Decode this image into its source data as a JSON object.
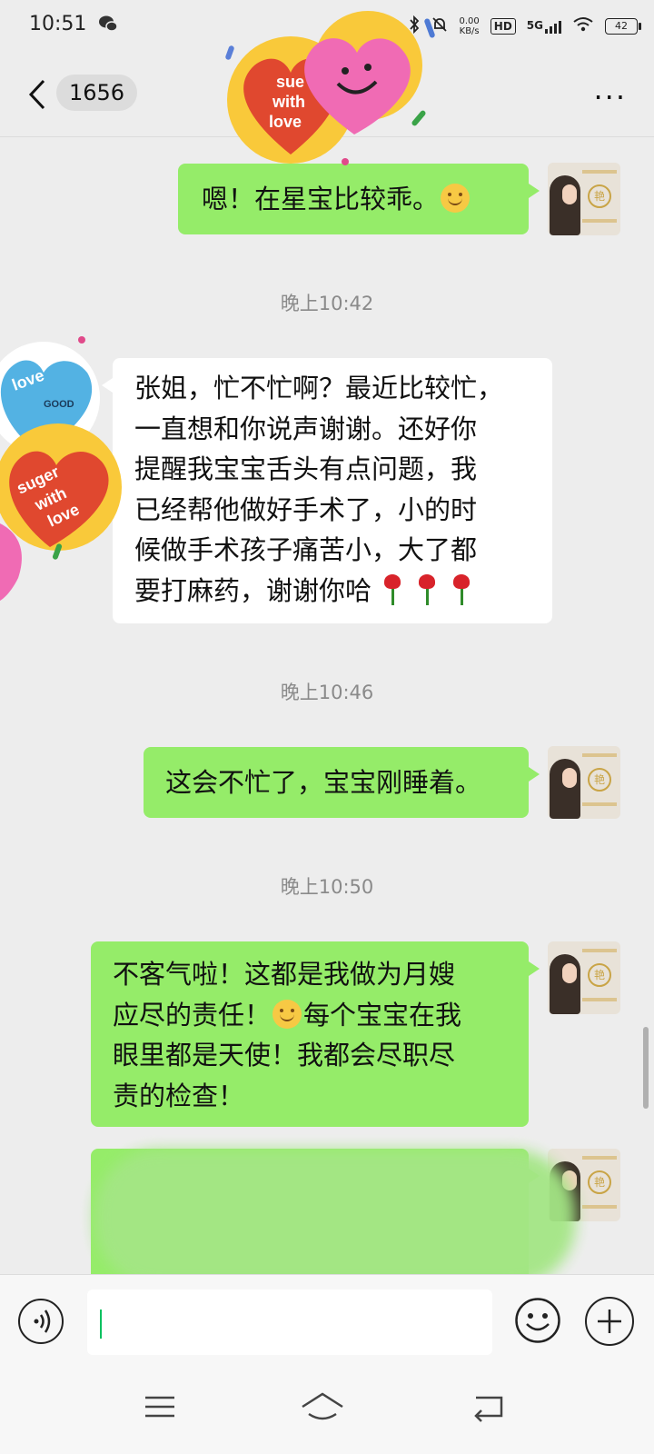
{
  "status_bar": {
    "time": "10:51",
    "net_speed_value": "0.00",
    "net_speed_unit": "KB/s",
    "hd": "HD",
    "network": "5G",
    "battery": "42"
  },
  "header": {
    "unread_count": "1656",
    "more": "···"
  },
  "messages": [
    {
      "side": "me",
      "text": "嗯！在星宝比较乖。"
    },
    {
      "type": "time",
      "text": "晚上10:42"
    },
    {
      "side": "them",
      "lines": [
        "张姐，忙不忙啊？最近比较忙，",
        "一直想和你说声谢谢。还好你",
        "提醒我宝宝舌头有点问题，我",
        "已经帮他做好手术了，小的时",
        "候做手术孩子痛苦小，大了都",
        "要打麻药，谢谢你哈"
      ]
    },
    {
      "type": "time",
      "text": "晚上10:46"
    },
    {
      "side": "me",
      "text": "这会不忙了，宝宝刚睡着。"
    },
    {
      "type": "time",
      "text": "晚上10:50"
    },
    {
      "side": "me",
      "lines": [
        "不客气啦！这都是我做为月嫂",
        "应尽的责任！",
        "每个宝宝在我",
        "眼里都是天使！我都会尽职尽",
        "责的检查！"
      ]
    }
  ],
  "stickers": {
    "top": [
      "sue",
      "with",
      "love"
    ],
    "side_top": [
      "love",
      "GOOD"
    ],
    "side_bottom": [
      "suger",
      "with",
      "love"
    ]
  },
  "avatar_badge": "艳",
  "icons": {
    "back": "chevron-left-icon",
    "more": "more-dots-icon",
    "voice": "voice-icon",
    "emoji": "emoji-icon",
    "add": "plus-icon",
    "menu": "menu-icon",
    "home": "home-icon",
    "back_nav": "back-nav-icon"
  },
  "colors": {
    "my_bubble": "#95ec69",
    "their_bubble": "#ffffff",
    "background": "#ededed",
    "caret": "#07c160"
  }
}
